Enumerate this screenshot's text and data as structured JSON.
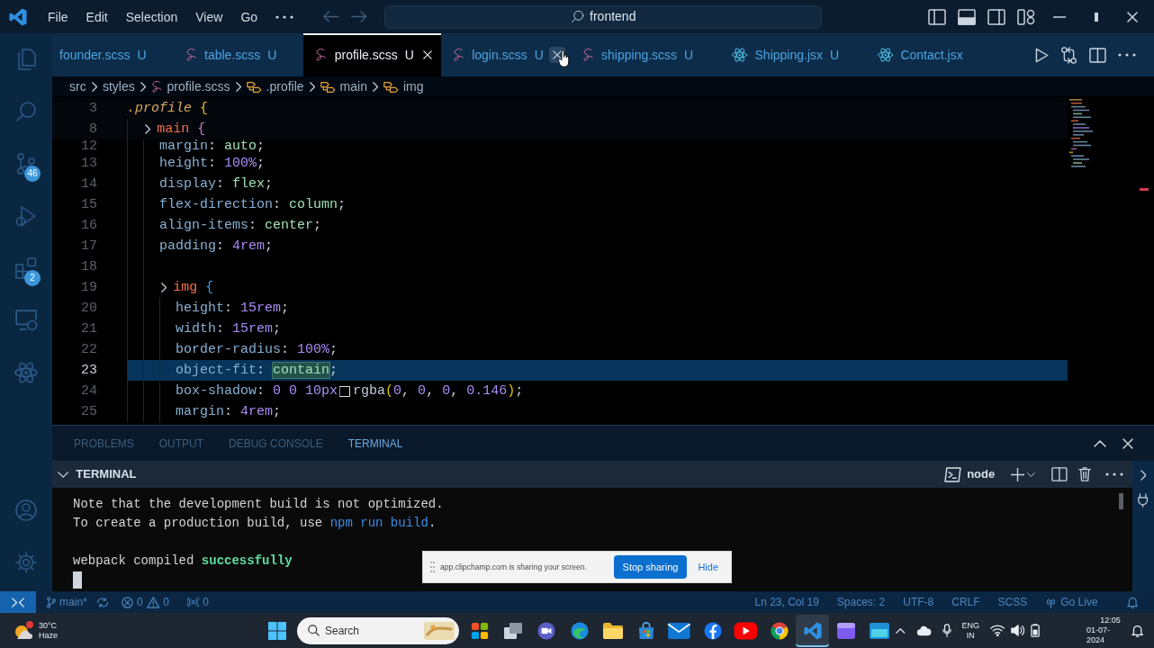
{
  "title_bar": {
    "menu": [
      {
        "label": "File"
      },
      {
        "label": "Edit"
      },
      {
        "label": "Selection"
      },
      {
        "label": "View"
      },
      {
        "label": "Go"
      }
    ],
    "command_center": {
      "label": "frontend"
    }
  },
  "activity_bar": {
    "items": [
      {
        "kind": "explorer"
      },
      {
        "kind": "search"
      },
      {
        "kind": "source_control",
        "badge": "46"
      },
      {
        "kind": "run"
      },
      {
        "kind": "extensions",
        "badge": "2"
      },
      {
        "kind": "remote"
      },
      {
        "kind": "react"
      }
    ],
    "bottom": [
      {
        "kind": "account"
      },
      {
        "kind": "settings"
      }
    ]
  },
  "tabs": [
    {
      "label": "founder.scss",
      "status": "U",
      "selected": false,
      "hovered": false
    },
    {
      "label": "table.scss",
      "status": "U",
      "kind": "scss",
      "selected": false,
      "hovered": false
    },
    {
      "label": "profile.scss",
      "status": "U",
      "kind": "scss",
      "selected": true,
      "hovered": false
    },
    {
      "label": "login.scss",
      "status": "U",
      "kind": "scss",
      "selected": false,
      "hovered": true
    },
    {
      "label": "shipping.scss",
      "status": "U",
      "kind": "scss",
      "selected": false,
      "hovered": false
    },
    {
      "label": "Shipping.jsx",
      "status": "U",
      "kind": "jsx",
      "selected": false,
      "hovered": false
    },
    {
      "label": "Contact.jsx",
      "kind": "jsx",
      "selected": false,
      "hovered": false
    }
  ],
  "breadcrumbs": [
    {
      "label": "src"
    },
    {
      "label": "styles"
    },
    {
      "label": "profile.scss",
      "kind": "scss"
    },
    {
      "label": ".profile",
      "kind": "selector"
    },
    {
      "label": "main",
      "kind": "selector"
    },
    {
      "label": "img",
      "kind": "selector"
    }
  ],
  "editor": {
    "lines": [
      {
        "number": "3",
        "sticky": true,
        "tokens": [
          {
            "text": ".profile",
            "kind": "selector"
          },
          {
            "text": " {",
            "kind": "brace_outer"
          }
        ],
        "children": [
          {
            "number": "8",
            "sticky": true,
            "fold": true,
            "tokens": [
              {
                "text": "main",
                "kind": "tag"
              },
              {
                "text": " {",
                "kind": "brace_middle"
              }
            ],
            "children": [
              {
                "number": "12",
                "tokens": [
                  {
                    "text": "margin",
                    "kind": "property"
                  },
                  {
                    "text": ": ",
                    "kind": "punct"
                  },
                  {
                    "text": "auto",
                    "kind": "keyword"
                  },
                  {
                    "text": ";",
                    "kind": "punct"
                  }
                ]
              },
              {
                "number": "13",
                "tokens": [
                  {
                    "text": "height",
                    "kind": "property"
                  },
                  {
                    "text": ": ",
                    "kind": "punct"
                  },
                  {
                    "text": "100%",
                    "kind": "number"
                  },
                  {
                    "text": ";",
                    "kind": "punct"
                  }
                ]
              },
              {
                "number": "14",
                "tokens": [
                  {
                    "text": "display",
                    "kind": "property"
                  },
                  {
                    "text": ": ",
                    "kind": "punct"
                  },
                  {
                    "text": "flex",
                    "kind": "keyword"
                  },
                  {
                    "text": ";",
                    "kind": "punct"
                  }
                ]
              },
              {
                "number": "15",
                "tokens": [
                  {
                    "text": "flex-direction",
                    "kind": "property"
                  },
                  {
                    "text": ": ",
                    "kind": "punct"
                  },
                  {
                    "text": "column",
                    "kind": "keyword"
                  },
                  {
                    "text": ";",
                    "kind": "punct"
                  }
                ]
              },
              {
                "number": "16",
                "tokens": [
                  {
                    "text": "align-items",
                    "kind": "property"
                  },
                  {
                    "text": ": ",
                    "kind": "punct"
                  },
                  {
                    "text": "center",
                    "kind": "keyword"
                  },
                  {
                    "text": ";",
                    "kind": "punct"
                  }
                ]
              },
              {
                "number": "17",
                "tokens": [
                  {
                    "text": "padding",
                    "kind": "property"
                  },
                  {
                    "text": ": ",
                    "kind": "punct"
                  },
                  {
                    "text": "4rem",
                    "kind": "number"
                  },
                  {
                    "text": ";",
                    "kind": "punct"
                  }
                ]
              },
              {
                "number": "18"
              },
              {
                "number": "19",
                "fold": true,
                "tokens": [
                  {
                    "text": "img",
                    "kind": "tag"
                  },
                  {
                    "text": " {",
                    "kind": "brace_inner"
                  }
                ],
                "children": [
                  {
                    "number": "20",
                    "tokens": [
                      {
                        "text": "height",
                        "kind": "property"
                      },
                      {
                        "text": ": ",
                        "kind": "punct"
                      },
                      {
                        "text": "15rem",
                        "kind": "number"
                      },
                      {
                        "text": ";",
                        "kind": "punct"
                      }
                    ]
                  },
                  {
                    "number": "21",
                    "tokens": [
                      {
                        "text": "width",
                        "kind": "property"
                      },
                      {
                        "text": ": ",
                        "kind": "punct"
                      },
                      {
                        "text": "15rem",
                        "kind": "number"
                      },
                      {
                        "text": ";",
                        "kind": "punct"
                      }
                    ]
                  },
                  {
                    "number": "22",
                    "tokens": [
                      {
                        "text": "border-radius",
                        "kind": "property"
                      },
                      {
                        "text": ": ",
                        "kind": "punct"
                      },
                      {
                        "text": "100%",
                        "kind": "number"
                      },
                      {
                        "text": ";",
                        "kind": "punct"
                      }
                    ]
                  },
                  {
                    "number": "23",
                    "current": true,
                    "tokens": [
                      {
                        "text": "object-fit",
                        "kind": "property"
                      },
                      {
                        "text": ": ",
                        "kind": "punct"
                      },
                      {
                        "text": "contain",
                        "kind": "keyword",
                        "highlight": true
                      },
                      {
                        "text": ";",
                        "kind": "punct"
                      }
                    ]
                  },
                  {
                    "number": "24",
                    "tokens": [
                      {
                        "text": "box-shadow",
                        "kind": "property"
                      },
                      {
                        "text": ": ",
                        "kind": "punct"
                      },
                      {
                        "text": "0 0 10px",
                        "kind": "number"
                      },
                      {
                        "kind": "swatch"
                      },
                      {
                        "text": "rgba",
                        "kind": "function"
                      },
                      {
                        "text": "(",
                        "kind": "paren"
                      },
                      {
                        "text": "0",
                        "kind": "number"
                      },
                      {
                        "text": ", ",
                        "kind": "punct"
                      },
                      {
                        "text": "0",
                        "kind": "number"
                      },
                      {
                        "text": ", ",
                        "kind": "punct"
                      },
                      {
                        "text": "0",
                        "kind": "number"
                      },
                      {
                        "text": ", ",
                        "kind": "punct"
                      },
                      {
                        "text": "0.146",
                        "kind": "number"
                      },
                      {
                        "text": ")",
                        "kind": "paren"
                      },
                      {
                        "text": ";",
                        "kind": "punct"
                      }
                    ]
                  },
                  {
                    "number": "25",
                    "tokens": [
                      {
                        "text": "margin",
                        "kind": "property"
                      },
                      {
                        "text": ": ",
                        "kind": "punct"
                      },
                      {
                        "text": "4rem",
                        "kind": "number"
                      },
                      {
                        "text": ";",
                        "kind": "punct"
                      }
                    ]
                  }
                ]
              }
            ]
          }
        ]
      }
    ]
  },
  "panel": {
    "tabs": [
      {
        "label": "PROBLEMS",
        "selected": false
      },
      {
        "label": "OUTPUT",
        "selected": false
      },
      {
        "label": "DEBUG CONSOLE",
        "selected": false
      },
      {
        "label": "TERMINAL",
        "selected": true
      }
    ],
    "terminal": {
      "title": "TERMINAL",
      "expanded": true,
      "profile": "node",
      "lines": [
        {
          "segments": [
            {
              "text": "Note that the development build is not optimized.",
              "kind": "plain"
            }
          ]
        },
        {
          "segments": [
            {
              "text": "To create a production build, use ",
              "kind": "plain"
            },
            {
              "text": "npm run build",
              "kind": "command"
            },
            {
              "text": ".",
              "kind": "plain"
            }
          ]
        },
        {
          "kind": "blank"
        },
        {
          "segments": [
            {
              "text": "webpack compiled ",
              "kind": "plain"
            },
            {
              "text": "successfully",
              "kind": "success"
            }
          ]
        }
      ],
      "cursor": true
    }
  },
  "share_bar": {
    "message": "app.clipchamp.com is sharing your screen.",
    "buttons": [
      {
        "label": "Stop sharing",
        "kind": "primary"
      },
      {
        "label": "Hide",
        "kind": "link"
      }
    ]
  },
  "status_bar": {
    "left": [
      {
        "kind": "remote"
      },
      {
        "kind": "branch",
        "label": "main*"
      },
      {
        "kind": "sync"
      },
      {
        "kind": "problems",
        "errors": "0",
        "warnings": "0"
      },
      {
        "kind": "ports",
        "label": "0"
      }
    ],
    "right": [
      {
        "label": "Ln 23, Col 19"
      },
      {
        "label": "Spaces: 2"
      },
      {
        "label": "UTF-8"
      },
      {
        "label": "CRLF"
      },
      {
        "label": "SCSS"
      },
      {
        "label": "Go Live",
        "kind": "golive"
      },
      {
        "kind": "bell"
      }
    ]
  },
  "taskbar": {
    "weather": {
      "temperature": "30°C",
      "condition": "Haze"
    },
    "search": {
      "placeholder": "Search"
    },
    "apps": [
      {
        "kind": "tiles",
        "selected": false
      },
      {
        "kind": "taskview",
        "selected": false
      },
      {
        "kind": "meet",
        "selected": false
      },
      {
        "kind": "edge",
        "selected": false
      },
      {
        "kind": "explorer",
        "selected": false
      },
      {
        "kind": "store",
        "selected": false
      },
      {
        "kind": "mail",
        "selected": false
      },
      {
        "kind": "facebook",
        "selected": false
      },
      {
        "kind": "youtube",
        "selected": false
      },
      {
        "kind": "chrome",
        "selected": false
      },
      {
        "kind": "vscode",
        "selected": true
      },
      {
        "kind": "clipchamp",
        "selected": false
      },
      {
        "kind": "teal",
        "selected": false
      }
    ],
    "language": {
      "label": "ENG",
      "region": "IN"
    },
    "clock": {
      "time": "12:05",
      "date": "01-07-2024"
    }
  }
}
